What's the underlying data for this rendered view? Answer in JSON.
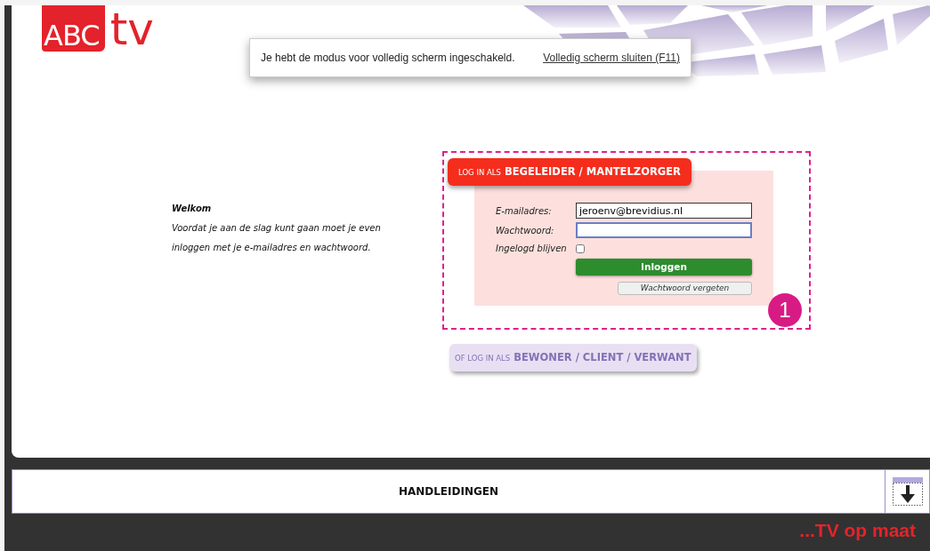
{
  "logo": {
    "box_text": "ABC",
    "text": "tv"
  },
  "fullscreen_notice": {
    "message": "Je hebt de modus voor volledig scherm ingeschakeld.",
    "link": "Volledig scherm sluiten (F11)"
  },
  "welcome": {
    "title": "Welkom",
    "lines": [
      "Voordat je aan de slag kunt gaan moet je even",
      "inloggen met je e-mailadres en wachtwoord."
    ]
  },
  "login": {
    "tab_prefix": "LOG IN ALS",
    "tab_title": "BEGELEIDER / MANTELZORGER",
    "fields": [
      {
        "label": "E-mailadres:",
        "value": "jeroenv@brevidius.nl",
        "focused": false
      },
      {
        "label": "Wachtwoord:",
        "focused": true
      }
    ],
    "remember": {
      "label": "Ingelogd blijven",
      "checked": false
    },
    "submit": "Inloggen",
    "forgot": "Wachtwoord vergeten",
    "callout": "1"
  },
  "alt_login": {
    "prefix": "OF LOG IN ALS",
    "title": "BEWONER / CLIENT / VERWANT"
  },
  "manuals_bar": {
    "title": "HANDLEIDINGEN"
  },
  "footer": {
    "slogan": "...TV op maat"
  }
}
